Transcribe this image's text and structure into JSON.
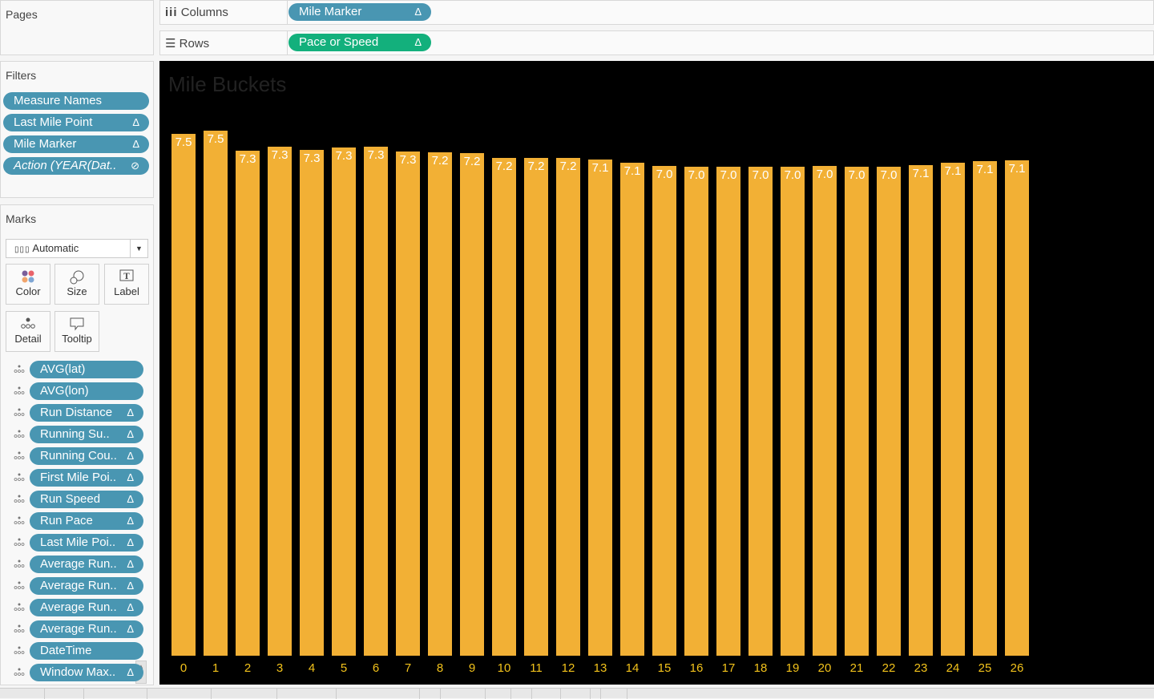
{
  "pages": {
    "title": "Pages"
  },
  "shelves": {
    "columns": {
      "label": "Columns",
      "pill": "Mile Marker",
      "pill_icon": "Δ"
    },
    "rows": {
      "label": "Rows",
      "pill": "Pace or Speed",
      "pill_icon": "Δ"
    }
  },
  "filters": {
    "title": "Filters",
    "items": [
      {
        "label": "Measure Names",
        "icon": ""
      },
      {
        "label": "Last Mile Point",
        "icon": "Δ"
      },
      {
        "label": "Mile Marker",
        "icon": "Δ"
      },
      {
        "label": "Action (YEAR(Dat..",
        "icon": "⊘"
      }
    ]
  },
  "marks": {
    "title": "Marks",
    "mark_type": "Automatic",
    "buttons": [
      "Color",
      "Size",
      "Label",
      "Detail",
      "Tooltip"
    ],
    "fields": [
      {
        "label": "AVG(lat)",
        "icon": ""
      },
      {
        "label": "AVG(lon)",
        "icon": ""
      },
      {
        "label": "Run Distance",
        "icon": "Δ"
      },
      {
        "label": "Running Su..",
        "icon": "Δ"
      },
      {
        "label": "Running Cou..",
        "icon": "Δ"
      },
      {
        "label": "First Mile Poi..",
        "icon": "Δ"
      },
      {
        "label": "Run Speed",
        "icon": "Δ"
      },
      {
        "label": "Run Pace",
        "icon": "Δ"
      },
      {
        "label": "Last Mile Poi..",
        "icon": "Δ"
      },
      {
        "label": "Average Run..",
        "icon": "Δ"
      },
      {
        "label": "Average Run..",
        "icon": "Δ"
      },
      {
        "label": "Average Run..",
        "icon": "Δ"
      },
      {
        "label": "Average Run..",
        "icon": "Δ"
      },
      {
        "label": "DateTime",
        "icon": ""
      },
      {
        "label": "Window Max..",
        "icon": "Δ"
      }
    ]
  },
  "colors": {
    "bar": "#f2b035",
    "pill": "#4996b2",
    "pill_green": "#13b07c",
    "axis_text": "#f2c21b"
  },
  "chart_data": {
    "type": "bar",
    "title": "Mile Buckets",
    "xlabel": "",
    "ylabel": "",
    "categories": [
      "0",
      "1",
      "2",
      "3",
      "4",
      "5",
      "6",
      "7",
      "8",
      "9",
      "10",
      "11",
      "12",
      "13",
      "14",
      "15",
      "16",
      "17",
      "18",
      "19",
      "20",
      "21",
      "22",
      "23",
      "24",
      "25",
      "26"
    ],
    "values": [
      7.5,
      7.55,
      7.26,
      7.32,
      7.27,
      7.3,
      7.32,
      7.25,
      7.24,
      7.22,
      7.16,
      7.16,
      7.16,
      7.13,
      7.08,
      7.04,
      7.03,
      7.03,
      7.03,
      7.03,
      7.04,
      7.03,
      7.03,
      7.05,
      7.08,
      7.11,
      7.12
    ],
    "labels": [
      "7.5",
      "7.5",
      "7.3",
      "7.3",
      "7.3",
      "7.3",
      "7.3",
      "7.3",
      "7.2",
      "7.2",
      "7.2",
      "7.2",
      "7.2",
      "7.1",
      "7.1",
      "7.0",
      "7.0",
      "7.0",
      "7.0",
      "7.0",
      "7.0",
      "7.0",
      "7.0",
      "7.1",
      "7.1",
      "7.1",
      "7.1"
    ],
    "ylim": [
      0,
      8.5
    ],
    "grid": false
  }
}
